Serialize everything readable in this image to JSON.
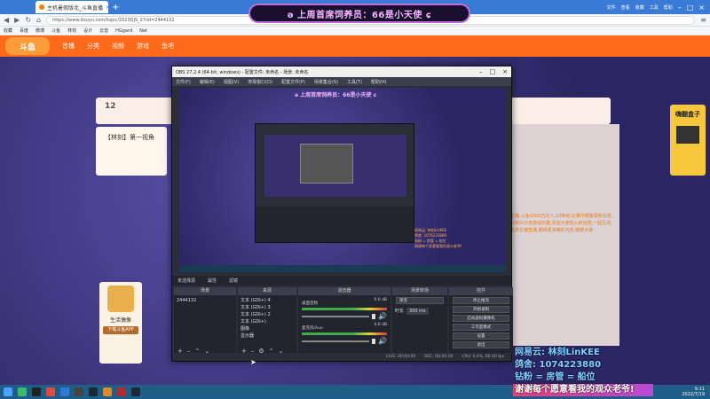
{
  "browser": {
    "tab_title": "主机暑假版北_斗鱼直播",
    "new_tab": "+",
    "url": "https://www.douyu.com/topic/2023DJS_2?rid=2444132",
    "bookmarks": [
      "收藏",
      "百度",
      "微博",
      "斗鱼",
      "林刻",
      "设计",
      "云音",
      "HGgard",
      "Net"
    ],
    "window_controls": [
      "文件",
      "查看",
      "收藏",
      "工具",
      "帮助"
    ]
  },
  "banner": {
    "text": "ə 上周首席饲养员：66是小天使 ɕ"
  },
  "site": {
    "logo": "斗鱼",
    "nav_items": [
      "首播",
      "分类",
      "视频",
      "游戏",
      "鱼吧"
    ],
    "room_title": "【林刻】第一视角",
    "room_fans_count": "12",
    "chat_text": "主播,斗鱼1000万达人,10等级,比赛中频繁更新信息,与观众分享游戏乐趣,欢迎大家加入粉丝团,一起互动,支持主播直播,期待更多精彩内容,谢谢大家",
    "ad_title": "嗨翻盒子",
    "badge": {
      "title": "生活偶像",
      "button": "下载斗鱼APP"
    }
  },
  "obs": {
    "title": "OBS 27.2.4 (64-bit, windows) - 配置文件: 未命名 - 场景: 未命名",
    "menu": [
      "文件(F)",
      "编辑(E)",
      "视图(V)",
      "停靠窗口(D)",
      "配置文件(P)",
      "场景集合(S)",
      "工具(T)",
      "帮助(H)"
    ],
    "preview_banner": "ə 上周首席饲养员：66是小天使 ɕ",
    "preview_overlay": [
      "网易云: 林刻LinKEE",
      "鸽舍: 1074223880",
      "钻粉 = 房管 = 船位",
      "谢谢每个愿意看我的观众老爷!"
    ],
    "status_strip": [
      "未选择源",
      "属性",
      "滤镜"
    ],
    "docks": {
      "scenes": {
        "title": "场景",
        "items": [
          "2444132"
        ]
      },
      "sources": {
        "title": "来源",
        "items": [
          "文本 (GDI+) 4",
          "文本 (GDI+) 3",
          "文本 (GDI+) 2",
          "文本 (GDI+)",
          "图像",
          "显示器"
        ]
      },
      "mixer": {
        "title": "混音器",
        "channels": [
          {
            "name": "桌面音频",
            "level": "0.0 dB"
          },
          {
            "name": "麦克风/Aux",
            "level": "0.0 dB"
          }
        ]
      },
      "transitions": {
        "title": "场景转场",
        "type": "渐变",
        "duration_label": "时长",
        "duration": "300 ms"
      },
      "controls": {
        "title": "控件",
        "buttons": [
          "停止推流",
          "开始录制",
          "启动虚拟摄像机",
          "工作室模式",
          "设置",
          "退出"
        ]
      }
    },
    "statusbar": [
      "LIVE: 00:00:00",
      "REC: 00:00:00",
      "CPU: 0.4%, 60.00 fps"
    ]
  },
  "overlay": {
    "lines": [
      "网易云: 林刻LinKEE",
      "鸽舍: 1074223880",
      "钻粉 = 房管 = 船位",
      "谢谢每个愿意看我的观众老爷!"
    ]
  },
  "taskbar": {
    "clock_time": "9:11",
    "clock_date": "2022/7/19"
  },
  "colors": {
    "douyu_orange": "#ff6a1a",
    "taskbar_blue": "#1f5e86",
    "overlay_cyan": "#7fd0ff"
  }
}
